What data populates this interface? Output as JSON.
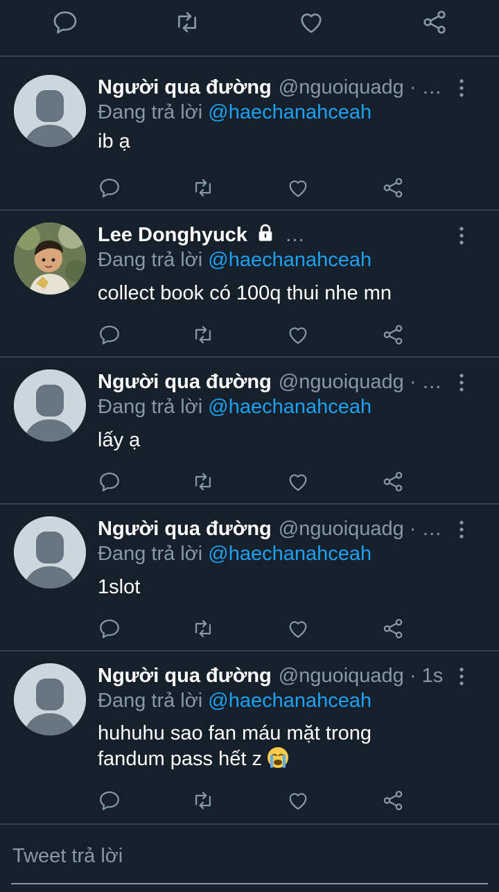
{
  "colors": {
    "background": "#15202b",
    "divider": "#38444d",
    "secondary_text": "#8899a6",
    "accent": "#1da1f2"
  },
  "top_actions": [
    "reply-icon",
    "retweet-icon",
    "like-icon",
    "share-icon"
  ],
  "tweets": [
    {
      "name": "Người qua đường",
      "handle": "@nguoiquadg · …",
      "replying_prefix": "Đang trả lời",
      "replying_to": "@haechanahceah",
      "text": "ib ạ",
      "avatar": "default-avatar"
    },
    {
      "name": "Lee Donghyuck",
      "handle": "…",
      "protected": true,
      "replying_prefix": "Đang trả lời",
      "replying_to": "@haechanahceah",
      "text": "collect book có 100q thui nhe mn",
      "avatar": "photo-avatar"
    },
    {
      "name": "Người qua đường",
      "handle": "@nguoiquadg · …",
      "replying_prefix": "Đang trả lời",
      "replying_to": "@haechanahceah",
      "text": "lấy ạ",
      "avatar": "default-avatar"
    },
    {
      "name": "Người qua đường",
      "handle": "@nguoiquadg · …",
      "replying_prefix": "Đang trả lời",
      "replying_to": "@haechanahceah",
      "text": "1slot",
      "avatar": "default-avatar"
    },
    {
      "name": "Người qua đường",
      "handle": "@nguoiquadg · 1s",
      "replying_prefix": "Đang trả lời",
      "replying_to": "@haechanahceah",
      "text_line1": "huhuhu sao fan máu mặt trong",
      "text_line2": "fandum pass hết z",
      "text_emoji": "crying-face-emoji",
      "avatar": "default-avatar"
    }
  ],
  "reply_box": {
    "placeholder": "Tweet trả lời"
  }
}
